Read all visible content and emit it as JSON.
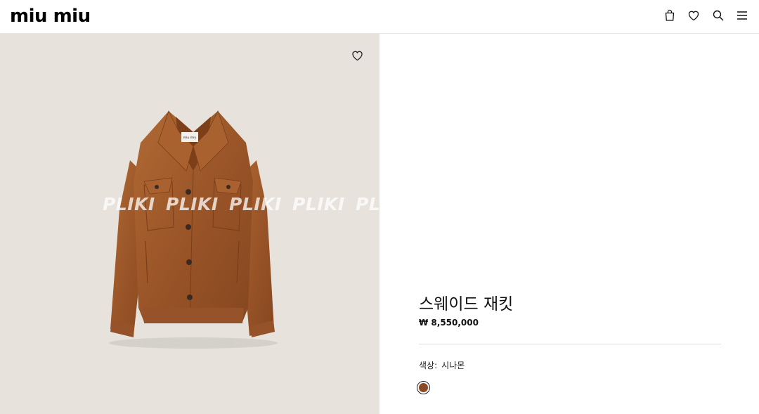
{
  "header": {
    "logo": "miu miu",
    "icons": [
      "bag-icon",
      "heart-icon",
      "search-icon",
      "menu-icon"
    ]
  },
  "product_image": {
    "watermark": "PLIKI",
    "background": "#e7e3dc",
    "favorite_icon": "heart-icon"
  },
  "product": {
    "title": "스웨이드 재킷",
    "price": "₩ 8,550,000",
    "color_label": "색상:",
    "color_name": "시나몬",
    "swatch_color": "#8b4a26"
  }
}
